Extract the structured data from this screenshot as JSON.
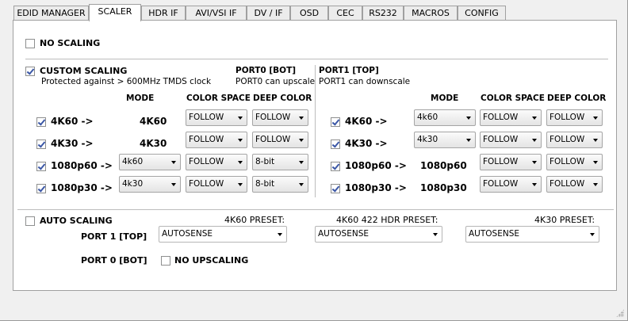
{
  "tabs": [
    {
      "label": "EDID MANAGER"
    },
    {
      "label": "SCALER"
    },
    {
      "label": "HDR IF"
    },
    {
      "label": "AVI/VSI IF"
    },
    {
      "label": "DV / IF"
    },
    {
      "label": "OSD"
    },
    {
      "label": "CEC"
    },
    {
      "label": "RS232"
    },
    {
      "label": "MACROS"
    },
    {
      "label": "CONFIG"
    }
  ],
  "active_tab": "SCALER",
  "no_scaling": {
    "label": "NO SCALING",
    "checked": false
  },
  "custom_scaling": {
    "label": "CUSTOM SCALING",
    "checked": true,
    "note": "Protected against > 600MHz TMDS clock"
  },
  "port0": {
    "title": "PORT0 [BOT]",
    "note": "PORT0 can upscale",
    "headers": {
      "mode": "MODE",
      "color_space": "COLOR SPACE",
      "deep_color": "DEEP COLOR"
    },
    "rows": [
      {
        "label": "4K60 ->",
        "checked": true,
        "mode_text": "4K60",
        "color_space": "FOLLOW",
        "deep_color": "FOLLOW"
      },
      {
        "label": "4K30 ->",
        "checked": true,
        "mode_text": "4K30",
        "color_space": "FOLLOW",
        "deep_color": "FOLLOW"
      },
      {
        "label": "1080p60 ->",
        "checked": true,
        "mode_select": "4k60",
        "color_space": "FOLLOW",
        "deep_color": "8-bit"
      },
      {
        "label": "1080p30 ->",
        "checked": true,
        "mode_select": "4k30",
        "color_space": "FOLLOW",
        "deep_color": "8-bit"
      }
    ]
  },
  "port1": {
    "title": "PORT1 [TOP]",
    "note": "PORT1 can downscale",
    "headers": {
      "mode": "MODE",
      "color_space": "COLOR SPACE",
      "deep_color": "DEEP COLOR"
    },
    "rows": [
      {
        "label": "4K60 ->",
        "checked": true,
        "mode_select": "4k60",
        "color_space": "FOLLOW",
        "deep_color": "FOLLOW"
      },
      {
        "label": "4K30 ->",
        "checked": true,
        "mode_select": "4k30",
        "color_space": "FOLLOW",
        "deep_color": "FOLLOW"
      },
      {
        "label": "1080p60 ->",
        "checked": true,
        "mode_text": "1080p60",
        "color_space": "FOLLOW",
        "deep_color": "FOLLOW"
      },
      {
        "label": "1080p30 ->",
        "checked": true,
        "mode_text": "1080p30",
        "color_space": "FOLLOW",
        "deep_color": "FOLLOW"
      }
    ]
  },
  "auto_scaling": {
    "label": "AUTO SCALING",
    "checked": false,
    "port1_label": "PORT 1 [TOP]",
    "port0_label": "PORT 0 [BOT]",
    "presets": [
      {
        "label": "4K60 PRESET:",
        "value": "AUTOSENSE"
      },
      {
        "label": "4K60 422 HDR PRESET:",
        "value": "AUTOSENSE"
      },
      {
        "label": "4K30 PRESET:",
        "value": "AUTOSENSE"
      }
    ],
    "no_upscaling": {
      "label": "NO UPSCALING",
      "checked": false
    }
  }
}
